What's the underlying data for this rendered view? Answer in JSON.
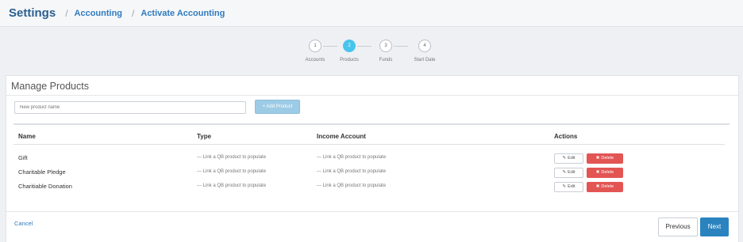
{
  "breadcrumb": {
    "title": "Settings",
    "sep1": "/",
    "item1": "Accounting",
    "sep2": "/",
    "item2": "Activate Accounting"
  },
  "stepper": {
    "steps": [
      {
        "number": "1",
        "label": "Accounts",
        "active": false
      },
      {
        "number": "2",
        "label": "Products",
        "active": true
      },
      {
        "number": "3",
        "label": "Funds",
        "active": false
      },
      {
        "number": "4",
        "label": "Start Date",
        "active": false
      }
    ]
  },
  "panel": {
    "title": "Manage Products",
    "input_placeholder": "New product name",
    "add_button_icon": "+",
    "add_button_label": "Add Product"
  },
  "table": {
    "columns": [
      "Name",
      "Type",
      "Income Account",
      "Actions"
    ],
    "rows": [
      {
        "name": "Gift",
        "type": "--- Link a QB product to populate",
        "income": "--- Link a QB product to populate"
      },
      {
        "name": "Charitable Pledge",
        "type": "--- Link a QB product to populate",
        "income": "--- Link a QB product to populate"
      },
      {
        "name": "Charitiable Donation",
        "type": "--- Link a QB product to populate",
        "income": "--- Link a QB product to populate"
      }
    ],
    "edit_label": "Edit",
    "edit_icon": "edit-icon",
    "delete_label": "Delete",
    "delete_icon": "times-icon"
  },
  "footer": {
    "cancel_label": "Cancel",
    "previous_label": "Previous",
    "next_label": "Next"
  },
  "colors": {
    "accent": "#2a83bf",
    "step_active": "#49c4ec",
    "delete": "#e25553",
    "add_button": "#9ccbe6"
  }
}
